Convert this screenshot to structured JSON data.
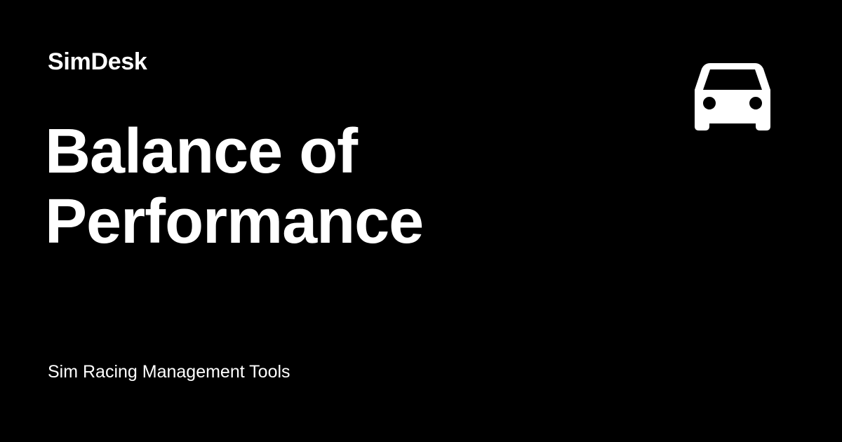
{
  "brand": "SimDesk",
  "title": "Balance of Performance",
  "tagline": "Sim Racing Management Tools",
  "icon": "car-icon",
  "colors": {
    "background": "#000000",
    "foreground": "#ffffff"
  }
}
